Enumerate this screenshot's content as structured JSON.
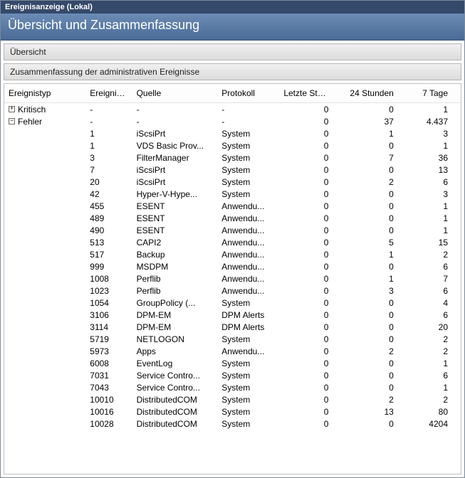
{
  "window_title": "Ereignisanzeige (Lokal)",
  "header_title": "Übersicht und Zusammenfassung",
  "section_overview": "Übersicht",
  "section_admin_events": "Zusammenfassung der administrativen Ereignisse",
  "columns": {
    "event_type": "Ereignistyp",
    "event_id": "Ereignis...",
    "source": "Quelle",
    "log": "Protokoll",
    "last_hour": "Letzte Stu...",
    "h24": "24 Stunden",
    "d7": "7 Tage"
  },
  "groups": [
    {
      "name": "Kritisch",
      "expand_symbol": "+",
      "event_id": "-",
      "source": "-",
      "log": "-",
      "last_hour": "0",
      "h24": "0",
      "d7": "1"
    },
    {
      "name": "Fehler",
      "expand_symbol": "−",
      "event_id": "-",
      "source": "-",
      "log": "-",
      "last_hour": "0",
      "h24": "37",
      "d7": "4.437"
    }
  ],
  "rows": [
    {
      "event_id": "1",
      "source": "iScsiPrt",
      "log": "System",
      "last_hour": "0",
      "h24": "1",
      "d7": "3"
    },
    {
      "event_id": "1",
      "source": "VDS Basic Prov...",
      "log": "System",
      "last_hour": "0",
      "h24": "0",
      "d7": "1"
    },
    {
      "event_id": "3",
      "source": "FilterManager",
      "log": "System",
      "last_hour": "0",
      "h24": "7",
      "d7": "36"
    },
    {
      "event_id": "7",
      "source": "iScsiPrt",
      "log": "System",
      "last_hour": "0",
      "h24": "0",
      "d7": "13"
    },
    {
      "event_id": "20",
      "source": "iScsiPrt",
      "log": "System",
      "last_hour": "0",
      "h24": "2",
      "d7": "6"
    },
    {
      "event_id": "42",
      "source": "Hyper-V-Hype...",
      "log": "System",
      "last_hour": "0",
      "h24": "0",
      "d7": "3"
    },
    {
      "event_id": "455",
      "source": "ESENT",
      "log": "Anwendu...",
      "last_hour": "0",
      "h24": "0",
      "d7": "1"
    },
    {
      "event_id": "489",
      "source": "ESENT",
      "log": "Anwendu...",
      "last_hour": "0",
      "h24": "0",
      "d7": "1"
    },
    {
      "event_id": "490",
      "source": "ESENT",
      "log": "Anwendu...",
      "last_hour": "0",
      "h24": "0",
      "d7": "1"
    },
    {
      "event_id": "513",
      "source": "CAPI2",
      "log": "Anwendu...",
      "last_hour": "0",
      "h24": "5",
      "d7": "15"
    },
    {
      "event_id": "517",
      "source": "Backup",
      "log": "Anwendu...",
      "last_hour": "0",
      "h24": "1",
      "d7": "2"
    },
    {
      "event_id": "999",
      "source": "MSDPM",
      "log": "Anwendu...",
      "last_hour": "0",
      "h24": "0",
      "d7": "6"
    },
    {
      "event_id": "1008",
      "source": "Perflib",
      "log": "Anwendu...",
      "last_hour": "0",
      "h24": "1",
      "d7": "7"
    },
    {
      "event_id": "1023",
      "source": "Perflib",
      "log": "Anwendu...",
      "last_hour": "0",
      "h24": "3",
      "d7": "6"
    },
    {
      "event_id": "1054",
      "source": "GroupPolicy (...",
      "log": "System",
      "last_hour": "0",
      "h24": "0",
      "d7": "4"
    },
    {
      "event_id": "3106",
      "source": "DPM-EM",
      "log": "DPM Alerts",
      "last_hour": "0",
      "h24": "0",
      "d7": "6"
    },
    {
      "event_id": "3114",
      "source": "DPM-EM",
      "log": "DPM Alerts",
      "last_hour": "0",
      "h24": "0",
      "d7": "20"
    },
    {
      "event_id": "5719",
      "source": "NETLOGON",
      "log": "System",
      "last_hour": "0",
      "h24": "0",
      "d7": "2"
    },
    {
      "event_id": "5973",
      "source": "Apps",
      "log": "Anwendu...",
      "last_hour": "0",
      "h24": "2",
      "d7": "2"
    },
    {
      "event_id": "6008",
      "source": "EventLog",
      "log": "System",
      "last_hour": "0",
      "h24": "0",
      "d7": "1"
    },
    {
      "event_id": "7031",
      "source": "Service Contro...",
      "log": "System",
      "last_hour": "0",
      "h24": "0",
      "d7": "6"
    },
    {
      "event_id": "7043",
      "source": "Service Contro...",
      "log": "System",
      "last_hour": "0",
      "h24": "0",
      "d7": "1"
    },
    {
      "event_id": "10010",
      "source": "DistributedCOM",
      "log": "System",
      "last_hour": "0",
      "h24": "2",
      "d7": "2"
    },
    {
      "event_id": "10016",
      "source": "DistributedCOM",
      "log": "System",
      "last_hour": "0",
      "h24": "13",
      "d7": "80"
    },
    {
      "event_id": "10028",
      "source": "DistributedCOM",
      "log": "System",
      "last_hour": "0",
      "h24": "0",
      "d7": "4204"
    }
  ]
}
